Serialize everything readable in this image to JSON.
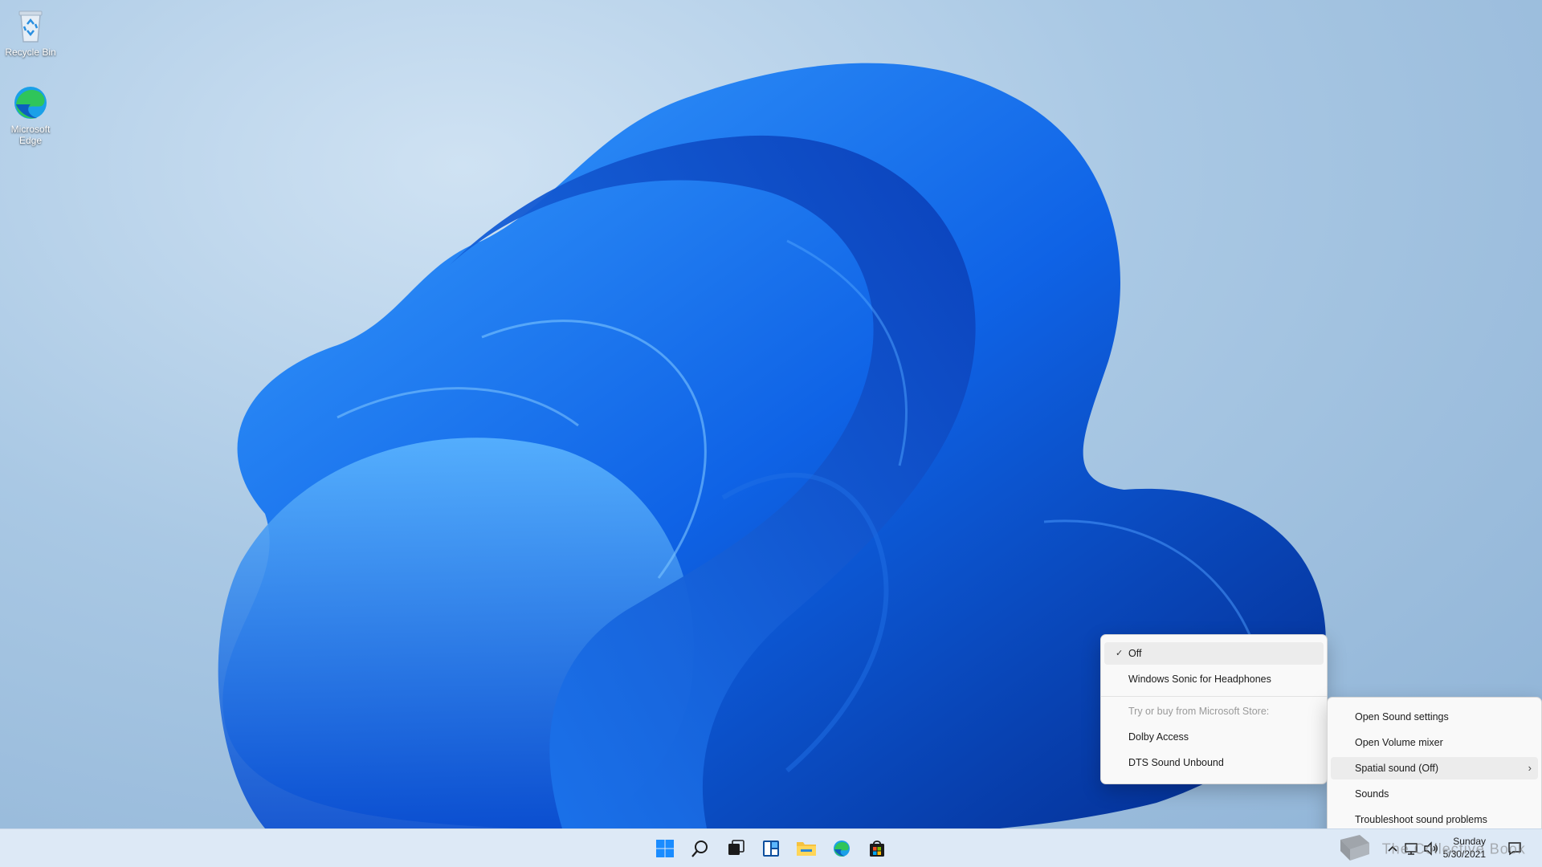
{
  "desktop": {
    "icons": [
      {
        "label": "Recycle Bin",
        "icon": "recycle-bin-icon"
      },
      {
        "label": "Microsoft Edge",
        "icon": "edge-icon"
      }
    ]
  },
  "taskbar": {
    "pinned": [
      {
        "name": "start",
        "icon": "windows-logo-icon"
      },
      {
        "name": "search",
        "icon": "search-icon"
      },
      {
        "name": "task-view",
        "icon": "task-view-icon"
      },
      {
        "name": "widgets",
        "icon": "widgets-icon"
      },
      {
        "name": "file-explorer",
        "icon": "folder-icon"
      },
      {
        "name": "edge",
        "icon": "edge-icon"
      },
      {
        "name": "store",
        "icon": "store-icon"
      }
    ],
    "tray": {
      "icons": [
        "chevron-up-icon",
        "network-icon",
        "volume-icon",
        "notification-icon"
      ],
      "clock": {
        "day": "Sunday",
        "date": "5/30/2021"
      }
    }
  },
  "spatial_submenu": {
    "items": [
      {
        "label": "Off",
        "checked": true,
        "active": true
      },
      {
        "label": "Windows Sonic for Headphones"
      }
    ],
    "store_header": "Try or buy from Microsoft Store:",
    "store_items": [
      {
        "label": "Dolby Access"
      },
      {
        "label": "DTS Sound Unbound"
      }
    ]
  },
  "sound_menu": {
    "items": [
      {
        "label": "Open Sound settings"
      },
      {
        "label": "Open Volume mixer"
      },
      {
        "label": "Spatial sound (Off)",
        "has_submenu": true,
        "active": true
      },
      {
        "label": "Sounds"
      },
      {
        "label": "Troubleshoot sound problems"
      }
    ]
  },
  "watermark": {
    "text": "The Collective Book"
  },
  "colors": {
    "accent": "#0a5fd8",
    "taskbar": "#dde9f6",
    "menu_bg": "#f9f9f9"
  }
}
